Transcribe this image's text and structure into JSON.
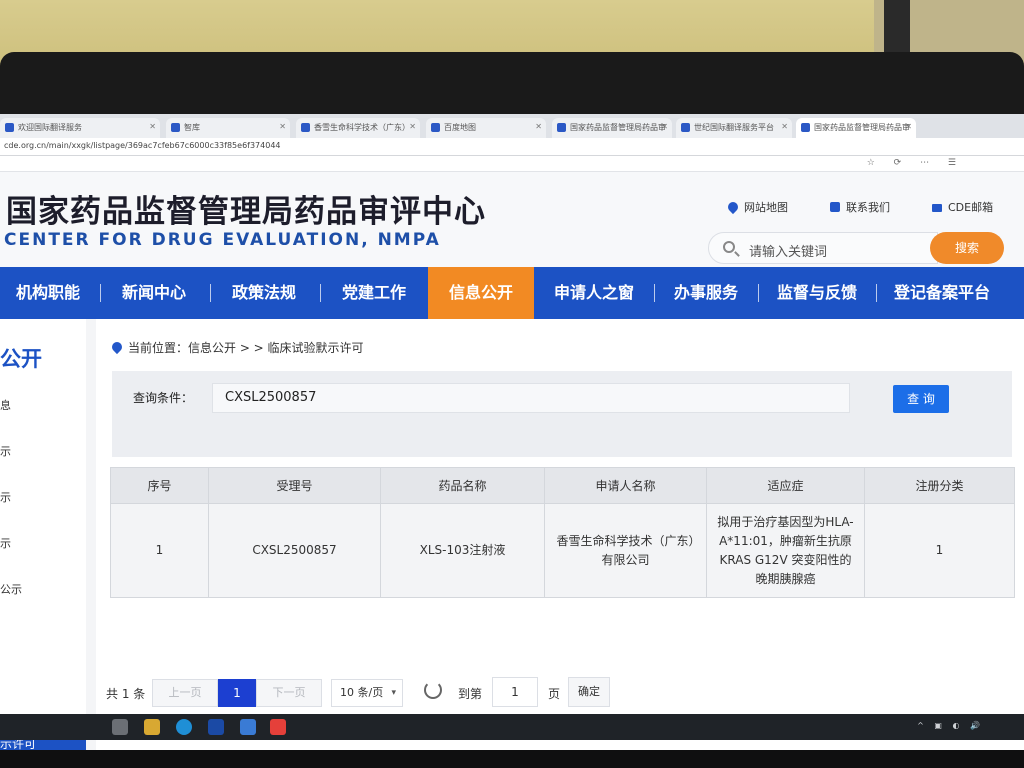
{
  "browser": {
    "tabs": [
      {
        "label": "欢迎国际翻译服务"
      },
      {
        "label": "智库"
      },
      {
        "label": "香雪生命科学技术（广东）"
      },
      {
        "label": "百度地图"
      },
      {
        "label": "国家药品监督管理局药品审"
      },
      {
        "label": "世纪国际翻译服务平台"
      },
      {
        "label": "国家药品监督管理局药品审"
      }
    ],
    "address": "cde.org.cn/main/xxgk/listpage/369ac7cfeb67c6000c33f85e6f374044"
  },
  "header": {
    "logo_cn": "国家药品监督管理局药品审评中心",
    "logo_en": "CENTER FOR DRUG EVALUATION, NMPA",
    "links": {
      "sitemap": "网站地图",
      "contact": "联系我们",
      "mail": "CDE邮箱"
    },
    "search_placeholder": "请输入关键词",
    "search_button": "搜索"
  },
  "nav": {
    "items": [
      "机构职能",
      "新闻中心",
      "政策法规",
      "党建工作",
      "信息公开",
      "申请人之窗",
      "办事服务",
      "监督与反馈",
      "登记备案平台"
    ],
    "active": "信息公开"
  },
  "sidebar": {
    "title": "公开",
    "items": [
      "息",
      "示",
      "示",
      "示",
      "公示"
    ],
    "active_item": "示许可",
    "last_item": "息"
  },
  "breadcrumb": {
    "label": "当前位置：信息公开 > > 临床试验默示许可"
  },
  "query": {
    "label": "查询条件：",
    "value": "CXSL2500857",
    "button": "查 询"
  },
  "table": {
    "headers": [
      "序号",
      "受理号",
      "药品名称",
      "申请人名称",
      "适应症",
      "注册分类"
    ],
    "rows": [
      [
        "1",
        "CXSL2500857",
        "XLS-103注射液",
        "香雪生命科学技术（广东）有限公司",
        "拟用于治疗基因型为HLA-A*11:01，肿瘤新生抗原KRAS G12V 突变阳性的晚期胰腺癌",
        "1"
      ]
    ]
  },
  "pager": {
    "total": "共 1 条",
    "prev": "上一页",
    "current": "1",
    "next": "下一页",
    "page_size": "10 条/页",
    "goto_label": "到第",
    "goto_value": "1",
    "unit": "页",
    "confirm": "确定"
  },
  "colors": {
    "nav_blue": "#1c52c4",
    "accent_orange": "#f28a23",
    "query_button": "#1c6ee8"
  }
}
